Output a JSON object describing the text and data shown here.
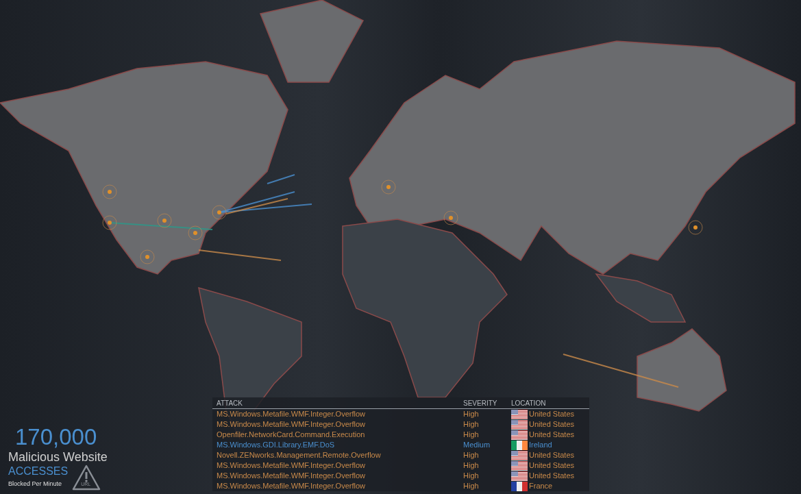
{
  "stats": {
    "count": "170,000",
    "title": "Malicious Website",
    "subtitle": "ACCESSES",
    "caption": "Blocked Per Minute",
    "badge_text": "URL"
  },
  "attack_table": {
    "columns": [
      "ATTACK",
      "SEVERITY",
      "LOCATION"
    ],
    "rows": [
      {
        "attack": "MS.Windows.Metafile.WMF.Integer.Overflow",
        "severity": "High",
        "kind": "high",
        "flag": {
          "kind": "us"
        },
        "location": "United States"
      },
      {
        "attack": "MS.Windows.Metafile.WMF.Integer.Overflow",
        "severity": "High",
        "kind": "high",
        "flag": {
          "kind": "us"
        },
        "location": "United States"
      },
      {
        "attack": "Openfiler.NetworkCard.Command.Execution",
        "severity": "High",
        "kind": "high",
        "flag": {
          "kind": "us"
        },
        "location": "United States"
      },
      {
        "attack": "MS.Windows.GDI.Library.EMF.DoS",
        "severity": "Medium",
        "kind": "medium",
        "flag": {
          "kind": "ie"
        },
        "location": "Ireland"
      },
      {
        "attack": "Novell.ZENworks.Management.Remote.Overflow",
        "severity": "High",
        "kind": "high",
        "flag": {
          "kind": "us"
        },
        "location": "United States"
      },
      {
        "attack": "MS.Windows.Metafile.WMF.Integer.Overflow",
        "severity": "High",
        "kind": "high",
        "flag": {
          "kind": "us"
        },
        "location": "United States"
      },
      {
        "attack": "MS.Windows.Metafile.WMF.Integer.Overflow",
        "severity": "High",
        "kind": "high",
        "flag": {
          "kind": "us"
        },
        "location": "United States"
      },
      {
        "attack": "MS.Windows.Metafile.WMF.Integer.Overflow",
        "severity": "High",
        "kind": "high",
        "flag": {
          "kind": "fr"
        },
        "location": "France"
      }
    ]
  }
}
